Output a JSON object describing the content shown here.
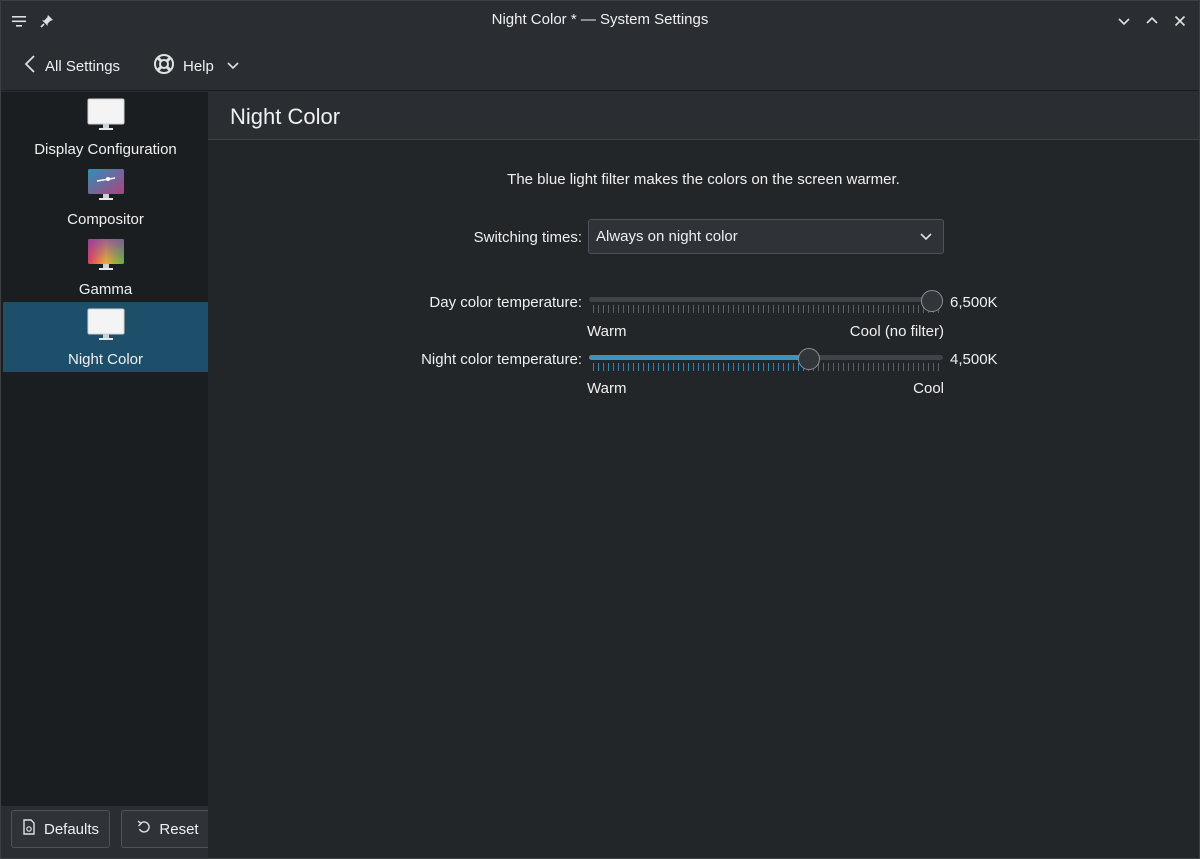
{
  "window": {
    "title": "Night Color * — System Settings"
  },
  "toolbar": {
    "back_label": "All Settings",
    "help_label": "Help"
  },
  "sidebar": {
    "items": [
      {
        "label": "Display Configuration",
        "icon": "monitor-icon",
        "active": false
      },
      {
        "label": "Compositor",
        "icon": "compositor-icon",
        "active": false
      },
      {
        "label": "Gamma",
        "icon": "gamma-icon",
        "active": false
      },
      {
        "label": "Night Color",
        "icon": "monitor-icon",
        "active": true
      }
    ]
  },
  "main": {
    "title": "Night Color",
    "description": "The blue light filter makes the colors on the screen warmer.",
    "switching": {
      "label": "Switching times:",
      "value": "Always on night color"
    },
    "day": {
      "label": "Day color temperature:",
      "value_text": "6,500K",
      "fraction": 1.0,
      "min_label": "Warm",
      "max_label": "Cool (no filter)"
    },
    "night": {
      "label": "Night color temperature:",
      "value_text": "4,500K",
      "fraction": 0.63,
      "min_label": "Warm",
      "max_label": "Cool"
    }
  },
  "footer": {
    "defaults_label": "Defaults",
    "reset_label": "Reset"
  },
  "colors": {
    "accent": "#3daee9",
    "selection": "#1e4f6a",
    "background": "#232629",
    "sidebar": "#1b1e20"
  }
}
